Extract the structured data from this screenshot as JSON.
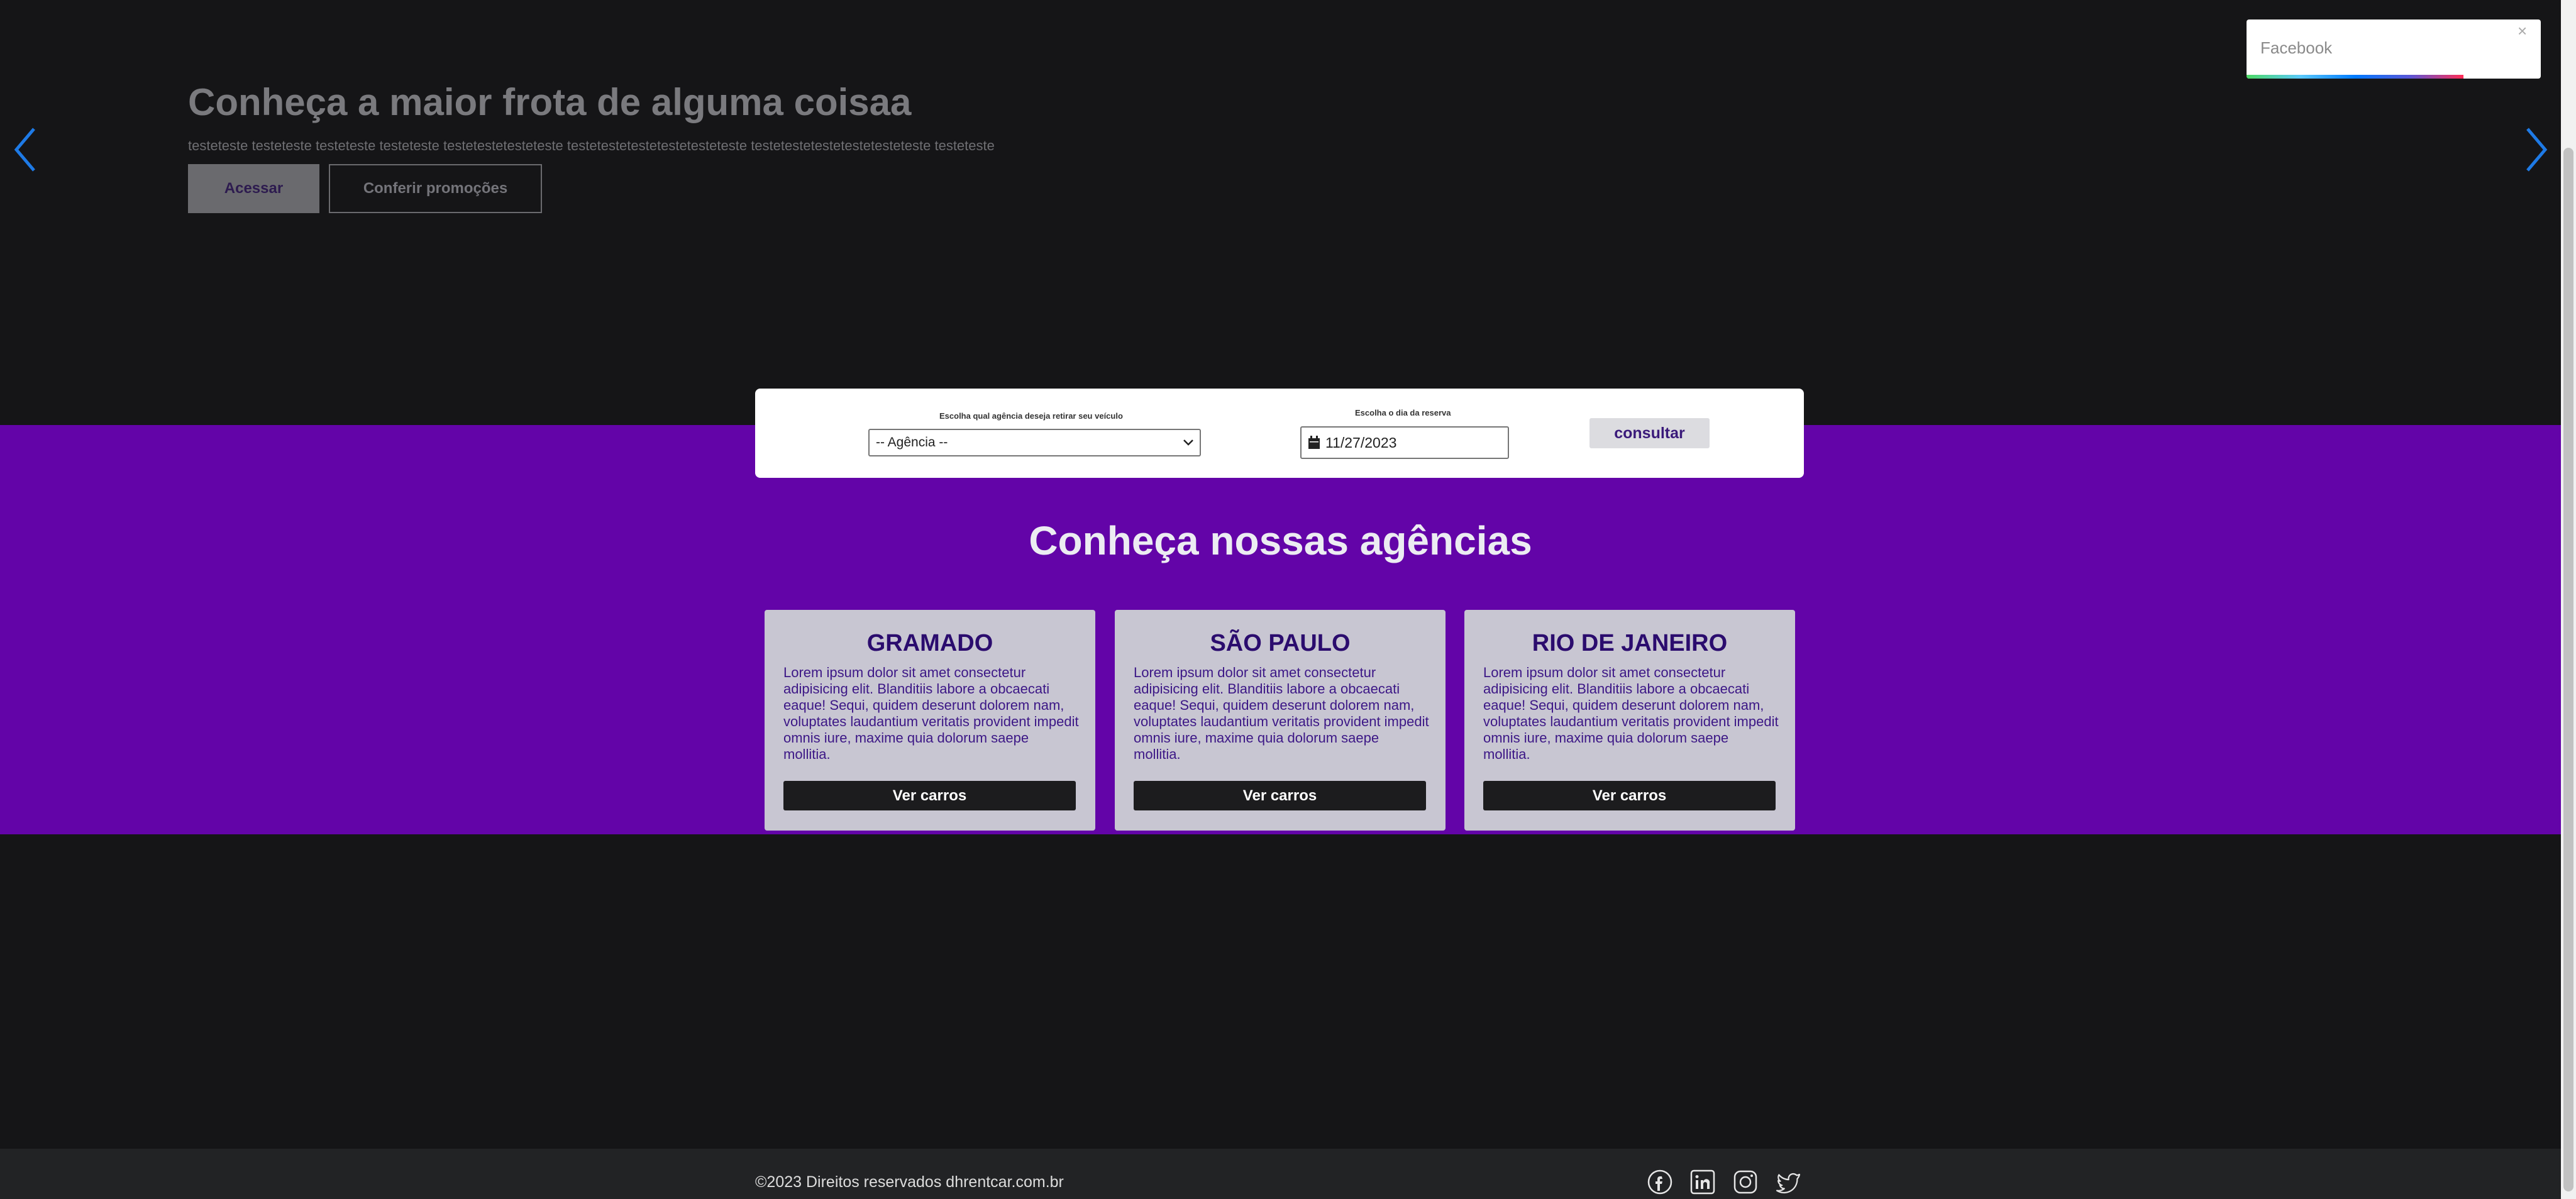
{
  "hero": {
    "title": "Conheça a maior frota de alguma coisaa",
    "subtitle": "testeteste testeteste testeteste testeteste testetestetesteteste testetestetestetestetesteteste testetestetestetestetesteteste testeteste",
    "btn_access": "Acessar",
    "btn_promos": "Conferir promoções"
  },
  "toast": {
    "text": "Facebook",
    "close": "×"
  },
  "search": {
    "agency_label": "Escolha qual agência deseja retirar seu veículo",
    "agency_selected": "-- Agência --",
    "date_label": "Escolha o dia da reserva",
    "date_value": "11/27/2023",
    "submit": "consultar"
  },
  "agencies": {
    "title": "Conheça nossas agências",
    "cards": [
      {
        "name": "GRAMADO",
        "text": "Lorem ipsum dolor sit amet consectetur adipisicing elit. Blanditiis labore a obcaecati eaque! Sequi, quidem deserunt dolorem nam, voluptates laudantium veritatis provident impedit omnis iure, maxime quia dolorum saepe mollitia.",
        "button": "Ver carros"
      },
      {
        "name": "SÃO PAULO",
        "text": "Lorem ipsum dolor sit amet consectetur adipisicing elit. Blanditiis labore a obcaecati eaque! Sequi, quidem deserunt dolorem nam, voluptates laudantium veritatis provident impedit omnis iure, maxime quia dolorum saepe mollitia.",
        "button": "Ver carros"
      },
      {
        "name": "RIO DE JANEIRO",
        "text": "Lorem ipsum dolor sit amet consectetur adipisicing elit. Blanditiis labore a obcaecati eaque! Sequi, quidem deserunt dolorem nam, voluptates laudantium veritatis provident impedit omnis iure, maxime quia dolorum saepe mollitia.",
        "button": "Ver carros"
      }
    ]
  },
  "footer": {
    "copyright": "©2023 Direitos reservados dhrentcar.com.br",
    "social_icons": [
      "facebook-icon",
      "linkedin-icon",
      "instagram-icon",
      "twitter-icon"
    ]
  },
  "colors": {
    "background": "#151517",
    "band": "#6304a8",
    "card": "#c8c6d2",
    "card_text": "#2b0c6e",
    "footer": "#222325",
    "arrow": "#1e7ae6"
  }
}
